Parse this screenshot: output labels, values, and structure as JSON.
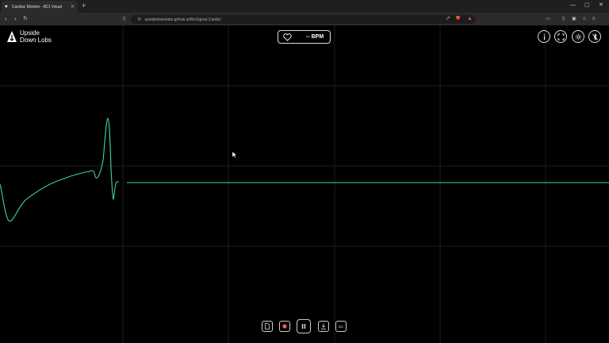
{
  "browser": {
    "tab_title": "Cardiac Monitor - BCI Visual",
    "new_tab_label": "+",
    "url": "upsidedownlabs.github.io/BioSignal-Cardio/",
    "window_controls": [
      "—",
      "▢",
      "✕"
    ]
  },
  "app": {
    "logo_line1": "Upside",
    "logo_line2": "Down Lobs",
    "bpm_value": "-- BPM",
    "top_buttons": [
      {
        "name": "info-button",
        "icon": "info-icon"
      },
      {
        "name": "fullscreen-button",
        "icon": "fullscreen-icon"
      },
      {
        "name": "theme-button",
        "icon": "sun-icon"
      },
      {
        "name": "disconnect-button",
        "icon": "bluetooth-off-icon"
      }
    ],
    "bottom_controls": [
      {
        "name": "export-button",
        "icon": "file-icon"
      },
      {
        "name": "record-button",
        "icon": "record-icon"
      },
      {
        "name": "pause-button",
        "icon": "pause-icon"
      },
      {
        "name": "download-button",
        "icon": "download-icon"
      },
      {
        "name": "dc-button",
        "label": "DC"
      }
    ],
    "colors": {
      "signal": "#3dd6a0",
      "record": "#ff5a5a",
      "grid": "#1e1e1e"
    }
  }
}
